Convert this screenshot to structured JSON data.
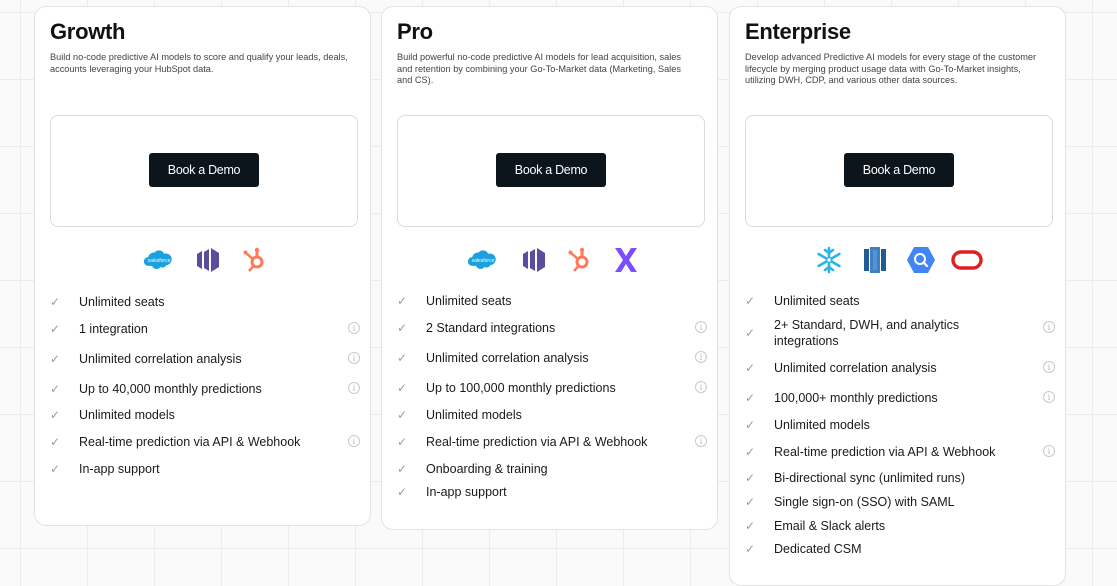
{
  "colors": {
    "button_bg": "#0b151b",
    "check": "#9a9a9a",
    "salesforce": "#1ba0e0",
    "marketo": "#5c4c9f",
    "hubspot": "#ff7a59",
    "connector_x": "#7b4dff",
    "snowflake": "#29b5e8",
    "redshift": "#205b97",
    "bigquery": "#4285f4",
    "oracle": "#e02020"
  },
  "plans": [
    {
      "name": "Growth",
      "description": "Build no-code predictive AI models to score and qualify your leads, deals, accounts leveraging your HubSpot data.",
      "cta": "Book a Demo",
      "integration_icons": [
        "salesforce-icon",
        "marketo-icon",
        "hubspot-icon"
      ],
      "features": [
        {
          "text": "Unlimited seats",
          "info": false
        },
        {
          "text": "1 integration",
          "info": true
        },
        {
          "text": "Unlimited correlation analysis",
          "info": true
        },
        {
          "text": "Up to 40,000 monthly predictions",
          "info": true
        },
        {
          "text": "Unlimited models",
          "info": false
        },
        {
          "text": "Real-time prediction via API & Webhook",
          "info": true
        },
        {
          "text": "In-app support",
          "info": false
        }
      ]
    },
    {
      "name": "Pro",
      "description": "Build powerful no-code predictive AI models for lead acquisition, sales and retention by combining your Go-To-Market data (Marketing, Sales and CS).",
      "cta": "Book a Demo",
      "integration_icons": [
        "salesforce-icon",
        "marketo-icon",
        "hubspot-icon",
        "connector-x-icon"
      ],
      "features": [
        {
          "text": "Unlimited seats",
          "info": false
        },
        {
          "text": "2 Standard integrations",
          "info": true
        },
        {
          "text": "Unlimited correlation analysis",
          "info": true
        },
        {
          "text": "Up to 100,000 monthly predictions",
          "info": true
        },
        {
          "text": "Unlimited models",
          "info": false
        },
        {
          "text": "Real-time prediction via API & Webhook",
          "info": true
        },
        {
          "text": "Onboarding & training",
          "info": false
        },
        {
          "text": "In-app support",
          "info": false
        }
      ]
    },
    {
      "name": "Enterprise",
      "description": "Develop advanced Predictive AI models for every stage of the customer lifecycle by merging product usage data with Go-To-Market insights, utilizing DWH, CDP, and various other data sources.",
      "cta": "Book a Demo",
      "integration_icons": [
        "snowflake-icon",
        "redshift-icon",
        "bigquery-icon",
        "oracle-icon"
      ],
      "features": [
        {
          "text": "Unlimited seats",
          "info": false
        },
        {
          "text": "2+ Standard, DWH, and analytics integrations",
          "info": true
        },
        {
          "text": "Unlimited correlation analysis",
          "info": true
        },
        {
          "text": "100,000+ monthly predictions",
          "info": true
        },
        {
          "text": "Unlimited models",
          "info": false
        },
        {
          "text": "Real-time prediction via API & Webhook",
          "info": true
        },
        {
          "text": "Bi-directional sync (unlimited runs)",
          "info": false
        },
        {
          "text": "Single sign-on (SSO) with SAML",
          "info": false
        },
        {
          "text": "Email & Slack alerts",
          "info": false
        },
        {
          "text": "Dedicated CSM",
          "info": false
        }
      ]
    }
  ],
  "check_glyph": "✓",
  "info_glyph": "i"
}
